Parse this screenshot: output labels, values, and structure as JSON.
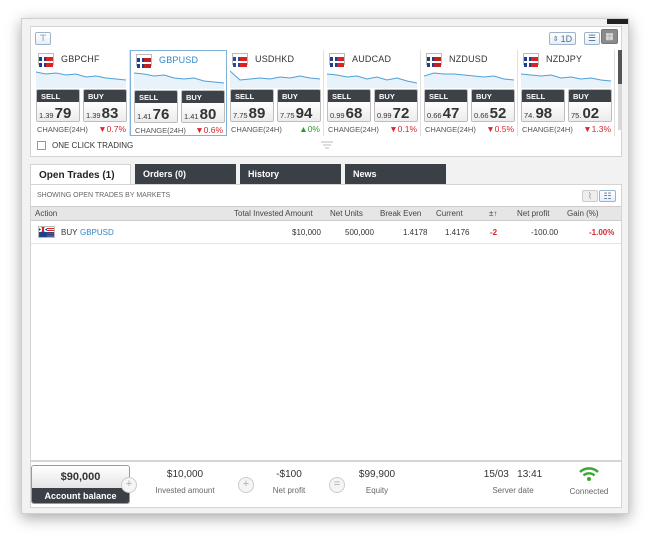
{
  "toolbar": {
    "filter_icon": "funnel-icon",
    "timeframe": "1D",
    "list_view_icon": "list-view-icon",
    "grid_view_icon": "grid-view-icon"
  },
  "markets": [
    {
      "symbol": "GBPCHF",
      "flag": "GB/CH",
      "sell_label": "SELL",
      "buy_label": "BUY",
      "sell_small": "1.39",
      "sell_big": "79",
      "buy_small": "1.39",
      "buy_big": "83",
      "change_label": "CHANGE(24H)",
      "change": "0.7%",
      "direction": "down"
    },
    {
      "symbol": "GBPUSD",
      "flag": "GB/US",
      "sell_label": "SELL",
      "buy_label": "BUY",
      "sell_small": "1.41",
      "sell_big": "76",
      "buy_small": "1.41",
      "buy_big": "80",
      "change_label": "CHANGE(24H)",
      "change": "0.6%",
      "direction": "down"
    },
    {
      "symbol": "USDHKD",
      "flag": "US/HK",
      "sell_label": "SELL",
      "buy_label": "BUY",
      "sell_small": "7.75",
      "sell_big": "89",
      "buy_small": "7.75",
      "buy_big": "94",
      "change_label": "CHANGE(24H)",
      "change": "0%",
      "direction": "up"
    },
    {
      "symbol": "AUDCAD",
      "flag": "AU/CA",
      "sell_label": "SELL",
      "buy_label": "BUY",
      "sell_small": "0.99",
      "sell_big": "68",
      "buy_small": "0.99",
      "buy_big": "72",
      "change_label": "CHANGE(24H)",
      "change": "0.1%",
      "direction": "down"
    },
    {
      "symbol": "NZDUSD",
      "flag": "NZ/US",
      "sell_label": "SELL",
      "buy_label": "BUY",
      "sell_small": "0.66",
      "sell_big": "47",
      "buy_small": "0.66",
      "buy_big": "52",
      "change_label": "CHANGE(24H)",
      "change": "0.5%",
      "direction": "down"
    },
    {
      "symbol": "NZDJPY",
      "flag": "NZ/JP",
      "sell_label": "SELL",
      "buy_label": "BUY",
      "sell_small": "74.",
      "sell_big": "98",
      "buy_small": "75.",
      "buy_big": "02",
      "change_label": "CHANGE(24H)",
      "change": "1.3%",
      "direction": "down"
    }
  ],
  "one_click": {
    "label": "ONE CLICK TRADING",
    "checked": false
  },
  "tabs": [
    {
      "label": "Open Trades (1)",
      "active": true
    },
    {
      "label": "Orders (0)",
      "active": false
    },
    {
      "label": "History",
      "active": false
    },
    {
      "label": "News",
      "active": false
    }
  ],
  "showing_label": "SHOWING OPEN TRADES BY MARKETS",
  "table": {
    "columns": [
      "Action",
      "Total Invested Amount",
      "Net Units",
      "Break Even",
      "Current",
      "±↑",
      "Net profit",
      "Gain (%)"
    ],
    "rows": [
      {
        "action": "BUY",
        "symbol": "GBPUSD",
        "invested": "$10,000",
        "units": "500,000",
        "break_even": "1.4178",
        "current": "1.4176",
        "pips": "-2",
        "net_profit": "-100.00",
        "gain": "-1.00%"
      }
    ]
  },
  "footer": {
    "balance_value": "$90,000",
    "balance_label": "Account balance",
    "invested_value": "$10,000",
    "invested_label": "Invested amount",
    "net_profit_value": "-$100",
    "net_profit_label": "Net profit",
    "equity_value": "$99,900",
    "equity_label": "Equity",
    "server_date": "15/03",
    "server_time": "13:41",
    "server_date_label": "Server date",
    "connection_label": "Connected",
    "connection_icon": "wifi-icon"
  },
  "colors": {
    "accent": "#2f88c8",
    "negative": "#d8262b",
    "positive": "#2a9a2a",
    "dark": "#3b4047",
    "connected": "#3aa832"
  }
}
